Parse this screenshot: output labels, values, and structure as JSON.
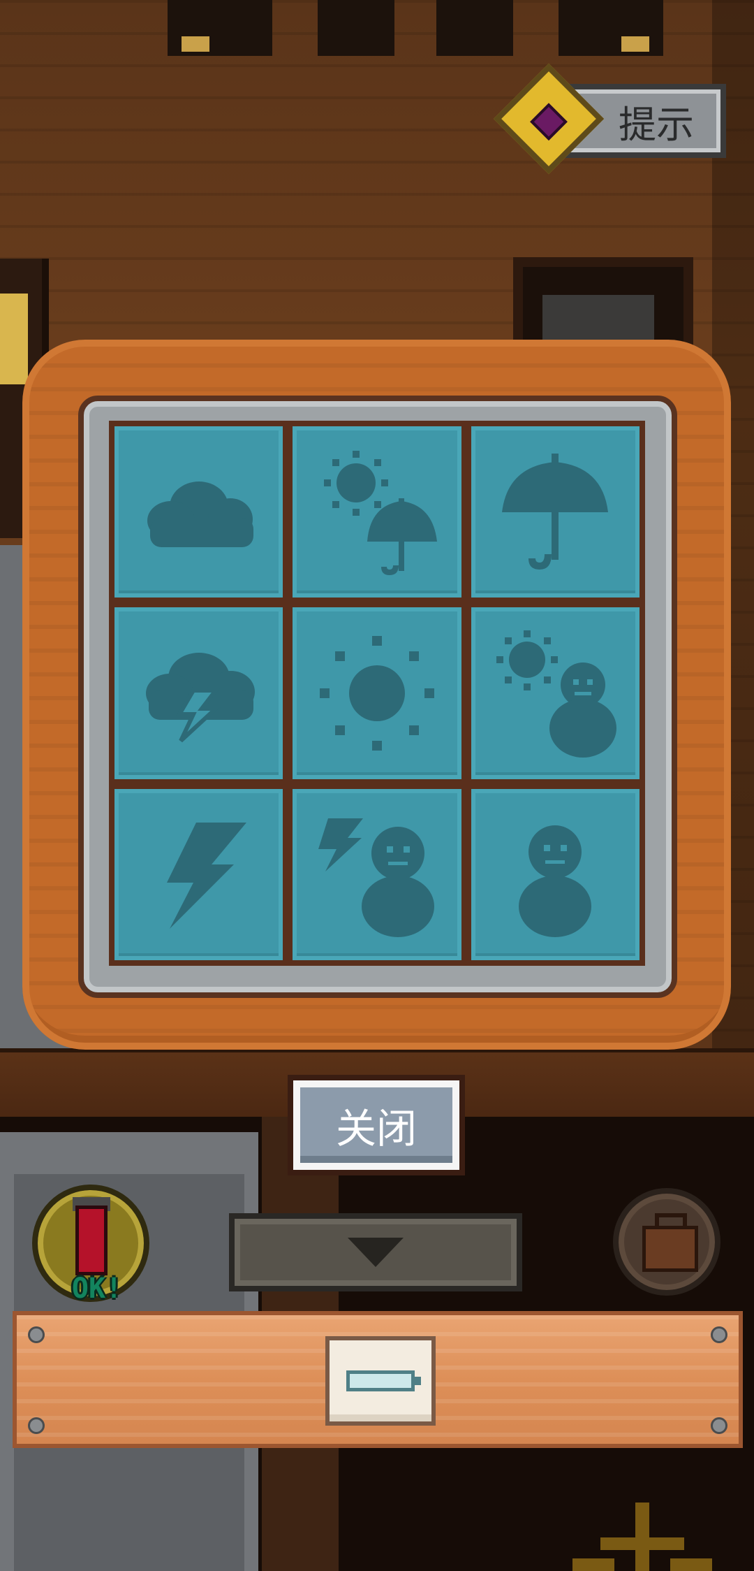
{
  "hint": {
    "label": "提示"
  },
  "panel": {
    "tiles": [
      {
        "name": "cloud"
      },
      {
        "name": "sun-umbrella"
      },
      {
        "name": "umbrella"
      },
      {
        "name": "storm-cloud"
      },
      {
        "name": "sun"
      },
      {
        "name": "sun-snowman"
      },
      {
        "name": "lightning"
      },
      {
        "name": "lightning-snowman"
      },
      {
        "name": "snowman"
      }
    ]
  },
  "close_button": {
    "label": "关闭"
  },
  "lantern": {
    "status": "OK!"
  },
  "inventory": {
    "items": [
      {
        "name": "fuse-icon"
      }
    ]
  },
  "colors": {
    "tile": "#3f98a9",
    "icon": "#2d6a77",
    "frame": "#c36a29"
  }
}
